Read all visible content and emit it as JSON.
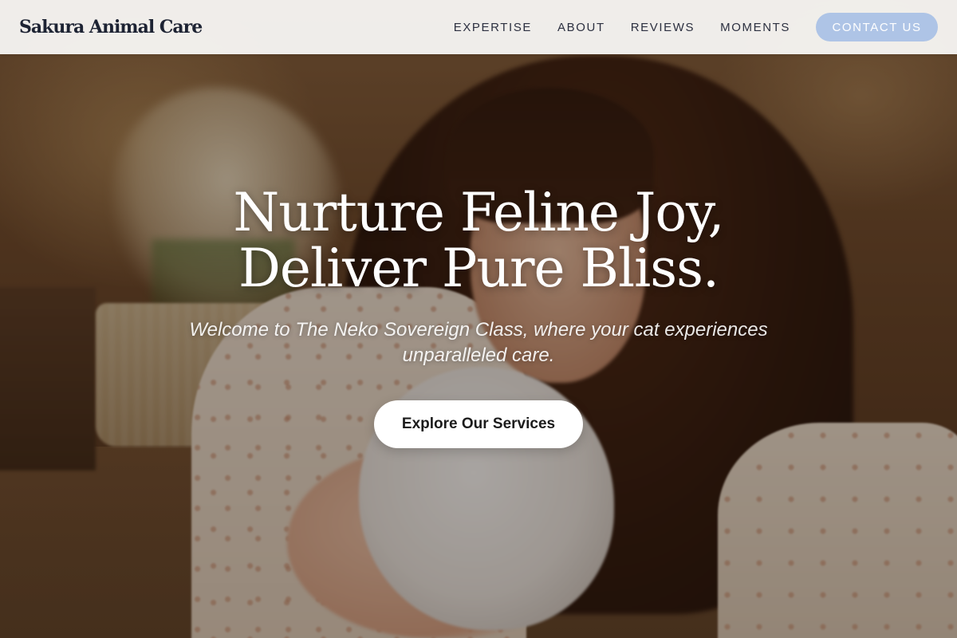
{
  "header": {
    "brand": "Sakura Animal Care",
    "nav": [
      {
        "label": "EXPERTISE"
      },
      {
        "label": "ABOUT"
      },
      {
        "label": "REVIEWS"
      },
      {
        "label": "MOMENTS"
      }
    ],
    "contact_label": "CONTACT US"
  },
  "hero": {
    "title_line1": "Nurture Feline Joy,",
    "title_line2": "Deliver Pure Bliss.",
    "subtitle_line1": "Welcome to The Neko Sovereign Class, where your cat experiences",
    "subtitle_line2": "unparalleled care.",
    "cta_label": "Explore Our Services"
  },
  "colors": {
    "accent": "#aec4e6",
    "brand_text": "#1d2333",
    "header_bg": "#f6f5f2"
  }
}
